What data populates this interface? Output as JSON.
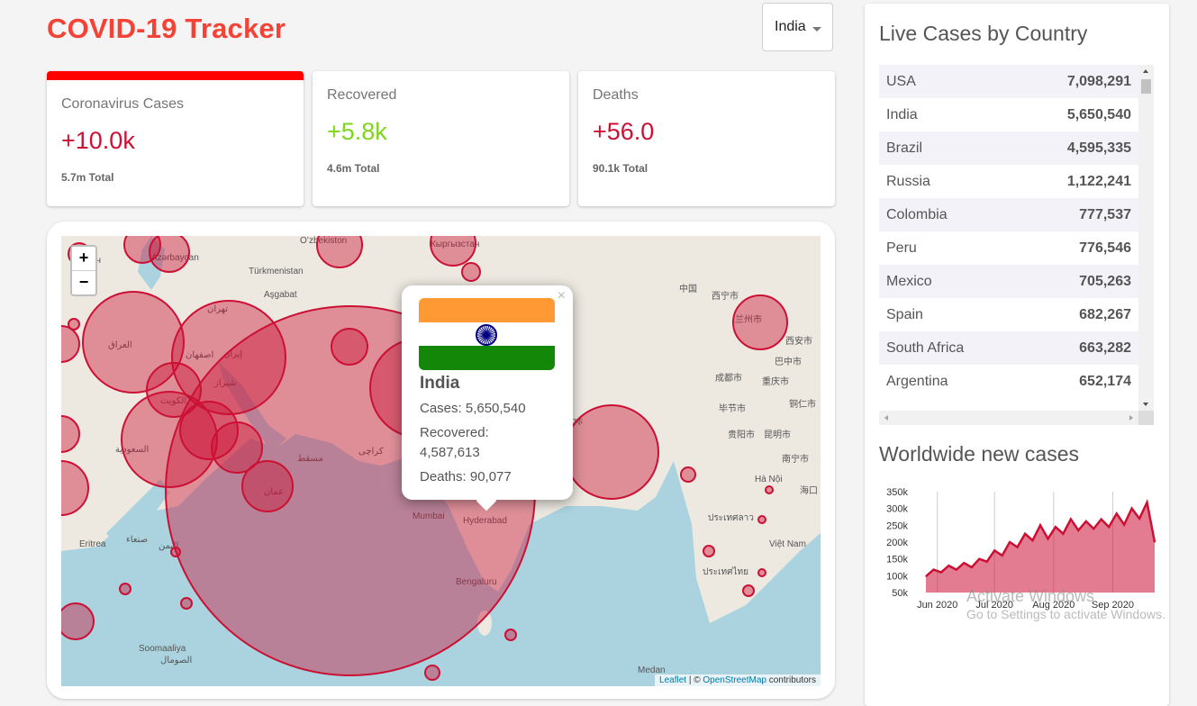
{
  "app": {
    "title": "COVID-19 Tracker"
  },
  "country_select": {
    "value": "India"
  },
  "cards": [
    {
      "label": "Coronavirus Cases",
      "value": "+10.0k",
      "total": "5.7m Total",
      "color": "#cc1034",
      "selected": true
    },
    {
      "label": "Recovered",
      "value": "+5.8k",
      "total": "4.6m Total",
      "color": "#7dd71d",
      "selected": false
    },
    {
      "label": "Deaths",
      "value": "+56.0",
      "total": "90.1k Total",
      "color": "#cc1034",
      "selected": false
    }
  ],
  "map": {
    "zoom_in": "+",
    "zoom_out": "−",
    "attribution": {
      "leaflet": "Leaflet",
      "sep": "| ©",
      "osm": "OpenStreetMap",
      "contributors": "contributors"
    },
    "labels": [
      "Türkmenistan",
      "Aşgabat",
      "Кыргызстан",
      "中国",
      "西宁市",
      "兰州市",
      "西安市",
      "巴中市",
      "成都市",
      "重庆市",
      "毕节市",
      "铜仁市",
      "贵阳市",
      "昆明市",
      "南宁市",
      "Hà Nội",
      "海口",
      "Mumbai",
      "Hyderabad",
      "Bengaluru",
      "Việt Nam",
      "العراق",
      "السعودية",
      "إيران",
      "عمان",
      "اليمن",
      "Eritrea",
      "Soomaaliya",
      "الصومال",
      "Medan",
      "ประเทศลาว",
      "ประเทศไทย",
      "Ереван",
      "Azərbaycan",
      "Oʻzbekiston",
      "تهران",
      "اصفهان",
      "شیراز",
      "الكويت",
      "مسقط",
      "کراچی",
      "صنعاء",
      "জাক"
    ],
    "circle_color": "#cc1034",
    "popup": {
      "country": "India",
      "flag_colors": [
        "#ff9933",
        "#ffffff",
        "#138808"
      ],
      "cases": "Cases: 5,650,540",
      "recovered_label": "Recovered:",
      "recovered_value": "4,587,613",
      "deaths": "Deaths: 90,077",
      "close": "×"
    }
  },
  "sidebar": {
    "table_title": "Live Cases by Country",
    "countries": [
      {
        "country": "USA",
        "cases": "7,098,291"
      },
      {
        "country": "India",
        "cases": "5,650,540"
      },
      {
        "country": "Brazil",
        "cases": "4,595,335"
      },
      {
        "country": "Russia",
        "cases": "1,122,241"
      },
      {
        "country": "Colombia",
        "cases": "777,537"
      },
      {
        "country": "Peru",
        "cases": "776,546"
      },
      {
        "country": "Mexico",
        "cases": "705,263"
      },
      {
        "country": "Spain",
        "cases": "682,267"
      },
      {
        "country": "South Africa",
        "cases": "663,282"
      },
      {
        "country": "Argentina",
        "cases": "652,174"
      }
    ],
    "chart_title": "Worldwide new cases"
  },
  "chart_data": {
    "type": "area",
    "title": "Worldwide new cases",
    "color": "#cc1034",
    "fill": "rgba(204,16,52,0.55)",
    "ylim": [
      50000,
      350000
    ],
    "yticks": [
      "350k",
      "300k",
      "250k",
      "200k",
      "150k",
      "100k",
      "50k"
    ],
    "xticks": [
      "Jun 2020",
      "Jul 2020",
      "Aug 2020",
      "Sep 2020"
    ],
    "x_range": [
      "2020-05-26",
      "2020-09-23"
    ],
    "x": [
      "2020-05-26",
      "2020-05-30",
      "2020-06-03",
      "2020-06-07",
      "2020-06-11",
      "2020-06-15",
      "2020-06-19",
      "2020-06-23",
      "2020-06-27",
      "2020-07-01",
      "2020-07-05",
      "2020-07-09",
      "2020-07-13",
      "2020-07-17",
      "2020-07-21",
      "2020-07-25",
      "2020-07-29",
      "2020-08-02",
      "2020-08-06",
      "2020-08-10",
      "2020-08-14",
      "2020-08-18",
      "2020-08-22",
      "2020-08-26",
      "2020-08-30",
      "2020-09-03",
      "2020-09-07",
      "2020-09-11",
      "2020-09-15",
      "2020-09-19",
      "2020-09-23"
    ],
    "values": [
      98000,
      118000,
      110000,
      130000,
      118000,
      138000,
      125000,
      150000,
      142000,
      175000,
      160000,
      200000,
      185000,
      225000,
      205000,
      250000,
      210000,
      245000,
      225000,
      268000,
      235000,
      262000,
      240000,
      268000,
      245000,
      285000,
      252000,
      300000,
      270000,
      318000,
      200000
    ]
  },
  "watermark": {
    "line1": "Activate Windows",
    "line2": "Go to Settings to activate Windows."
  }
}
